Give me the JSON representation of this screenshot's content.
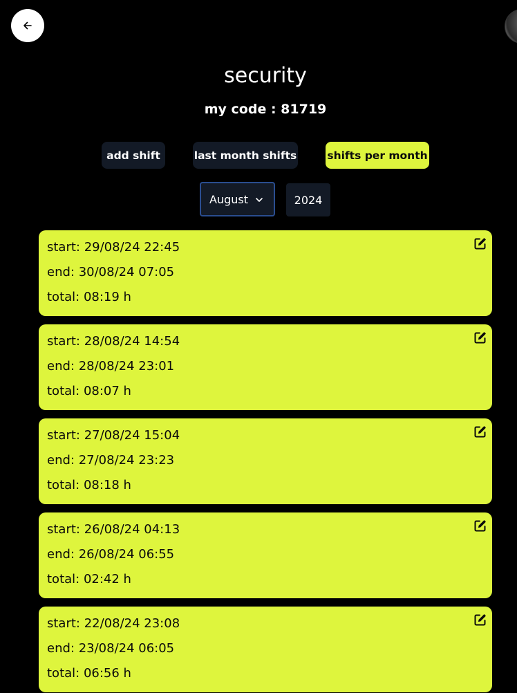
{
  "header": {
    "title": "security",
    "code_text": "my code : 81719"
  },
  "icons": {
    "back": "arrow-left-icon",
    "edit": "edit-square-pen-icon",
    "dropdown": "chevron-down-icon"
  },
  "buttons": {
    "add_shift": "add shift",
    "last_month": "last month shifts",
    "per_month": "shifts per month",
    "active": "per_month"
  },
  "filters": {
    "month": "August",
    "year": "2024"
  },
  "colors": {
    "background": "#000000",
    "accent": "#def53d",
    "button_dark": "#131a26",
    "select_border": "#2a4d8f"
  },
  "shifts": [
    {
      "start": "start: 29/08/24 22:45",
      "end": "end: 30/08/24 07:05",
      "total": "total: 08:19 h"
    },
    {
      "start": "start: 28/08/24 14:54",
      "end": "end: 28/08/24 23:01",
      "total": "total: 08:07 h"
    },
    {
      "start": "start: 27/08/24 15:04",
      "end": "end: 27/08/24 23:23",
      "total": "total: 08:18 h"
    },
    {
      "start": "start: 26/08/24 04:13",
      "end": "end: 26/08/24 06:55",
      "total": "total: 02:42 h"
    },
    {
      "start": "start: 22/08/24 23:08",
      "end": "end: 23/08/24 06:05",
      "total": "total: 06:56 h"
    }
  ]
}
